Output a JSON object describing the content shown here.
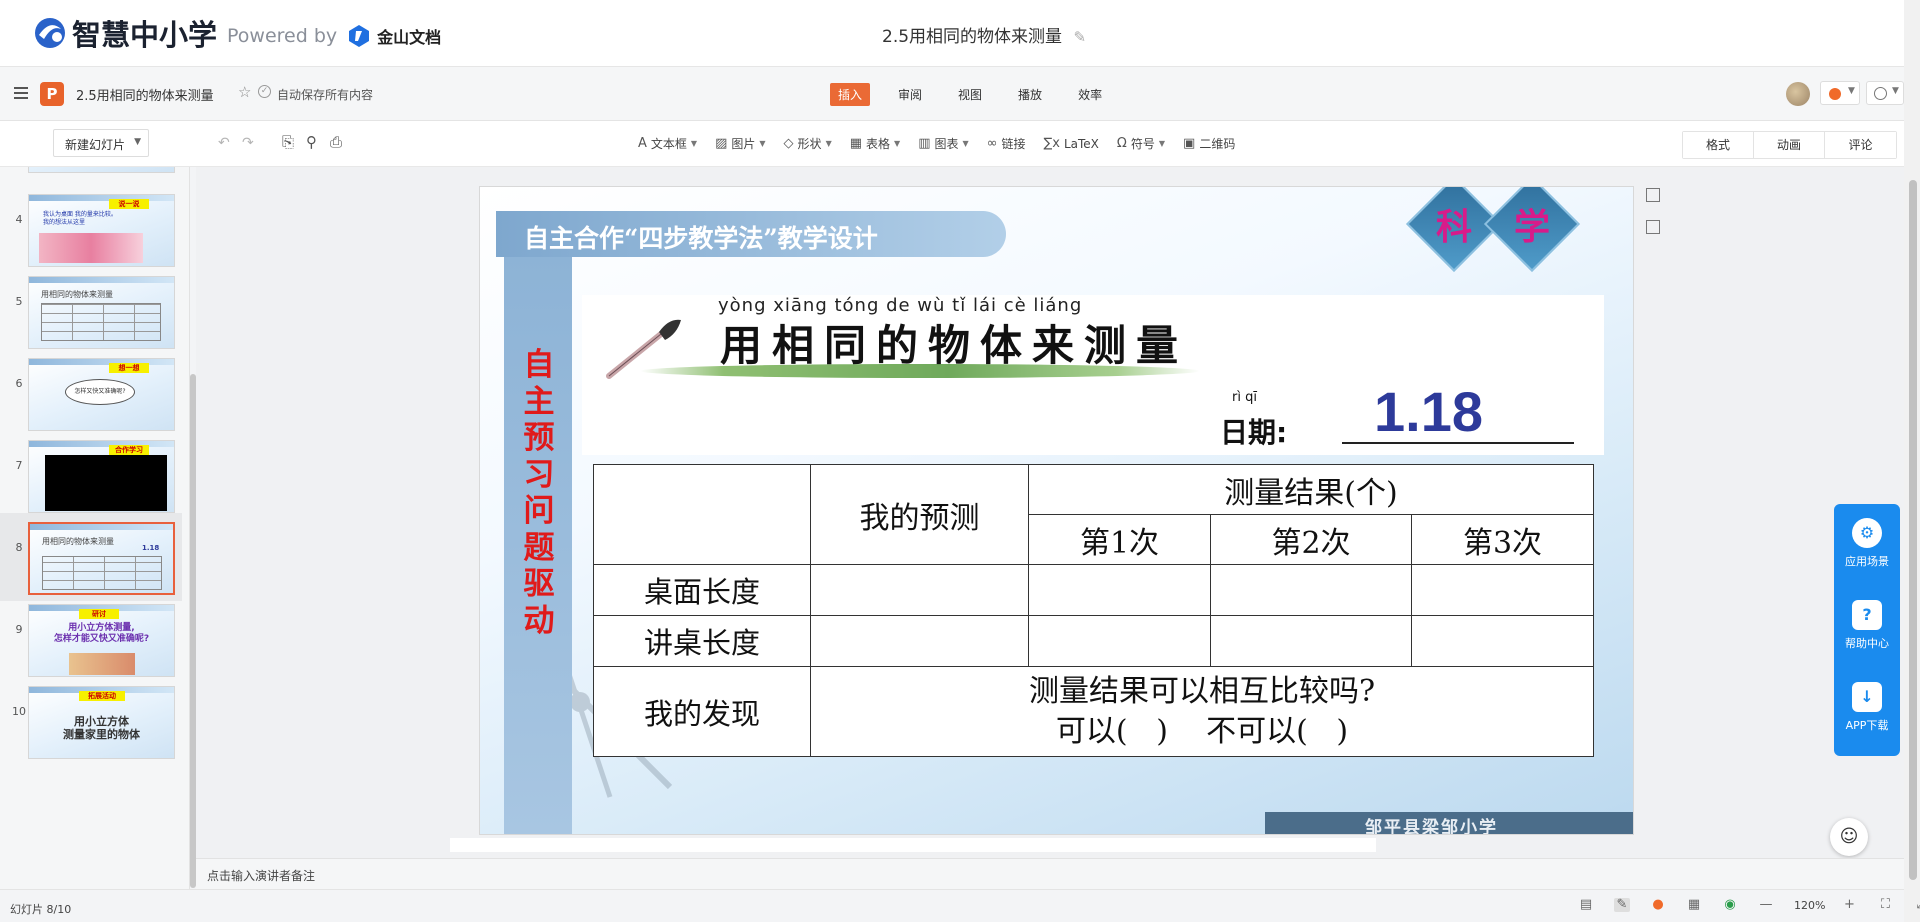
{
  "topbar": {
    "logo_text": "智慧中小学",
    "powered_by": "Powered by",
    "partner": "金山文档",
    "doc_title": "2.5用相同的物体来测量",
    "edit_icon": "pencil-icon"
  },
  "appbar": {
    "title": "2.5用相同的物体来测量",
    "app_icon": "P",
    "autosave": "自动保存所有内容",
    "menus": [
      "插入",
      "审阅",
      "视图",
      "播放",
      "效率"
    ],
    "active_menu": "插入"
  },
  "toolbar": {
    "new_slide": "新建幻灯片",
    "items": [
      {
        "icon": "textbox-icon",
        "glyph": "A",
        "label": "文本框",
        "dropdown": true
      },
      {
        "icon": "image-icon",
        "glyph": "▨",
        "label": "图片",
        "dropdown": true
      },
      {
        "icon": "shape-icon",
        "glyph": "◇",
        "label": "形状",
        "dropdown": true
      },
      {
        "icon": "table-icon",
        "glyph": "▦",
        "label": "表格",
        "dropdown": true
      },
      {
        "icon": "chart-icon",
        "glyph": "▥",
        "label": "图表",
        "dropdown": true
      },
      {
        "icon": "link-icon",
        "glyph": "∞",
        "label": "链接",
        "dropdown": false
      },
      {
        "icon": "latex-icon",
        "glyph": "∑x",
        "label": "LaTeX",
        "dropdown": false
      },
      {
        "icon": "symbol-icon",
        "glyph": "Ω",
        "label": "符号",
        "dropdown": true
      },
      {
        "icon": "qrcode-icon",
        "glyph": "▣",
        "label": "二维码",
        "dropdown": false
      }
    ],
    "right_tabs": [
      "格式",
      "动画",
      "评论"
    ]
  },
  "thumbnails": [
    {
      "num": "4",
      "tag": "说一说",
      "lines": [
        "我认为桌面    我的量来比较。",
        "我的想法从这里"
      ]
    },
    {
      "num": "5",
      "title": "用相同的物体来测量"
    },
    {
      "num": "6",
      "tag": "想一想",
      "cloud": "怎样又快又准确呢?"
    },
    {
      "num": "7",
      "tag": "合作学习"
    },
    {
      "num": "8",
      "title": "用相同的物体来测量",
      "date": "1.18",
      "selected": true
    },
    {
      "num": "9",
      "tag": "研讨",
      "lines": [
        "用小立方体测量,",
        "怎样才能又快又准确呢?"
      ]
    },
    {
      "num": "10",
      "tag": "拓展活动",
      "lines": [
        "用小立方体",
        "测量家里的物体"
      ]
    }
  ],
  "slide": {
    "header": "自主合作“四步教学法”教学设计",
    "badge1": "科",
    "badge2": "学",
    "side_text": "自主预习 问题驱动",
    "pinyin": "yòng xiāng tóng de wù tǐ lái cè liáng",
    "title": "用相同的物体来测量",
    "date_pinyin": "rì qī",
    "date_label": "日期:",
    "date_value": "1.18",
    "table": {
      "predict": "我的预测",
      "results": "测量结果(个)",
      "trial1": "第1次",
      "trial2": "第2次",
      "trial3": "第3次",
      "row1": "桌面长度",
      "row2": "讲桌长度",
      "row3": "我的发现",
      "question": "测量结果可以相互比较吗?",
      "options": "可以(   )    不可以(   )"
    },
    "footer": "邹平县梁邹小学"
  },
  "float_panel": [
    {
      "icon": "app-scene-icon",
      "label": "应用场景"
    },
    {
      "icon": "help-center-icon",
      "label": "帮助中心"
    },
    {
      "icon": "app-download-icon",
      "label": "APP下载"
    }
  ],
  "notes_placeholder": "点击输入演讲者备注",
  "status": {
    "slide_counter": "幻灯片 8/10",
    "zoom": "120%"
  }
}
